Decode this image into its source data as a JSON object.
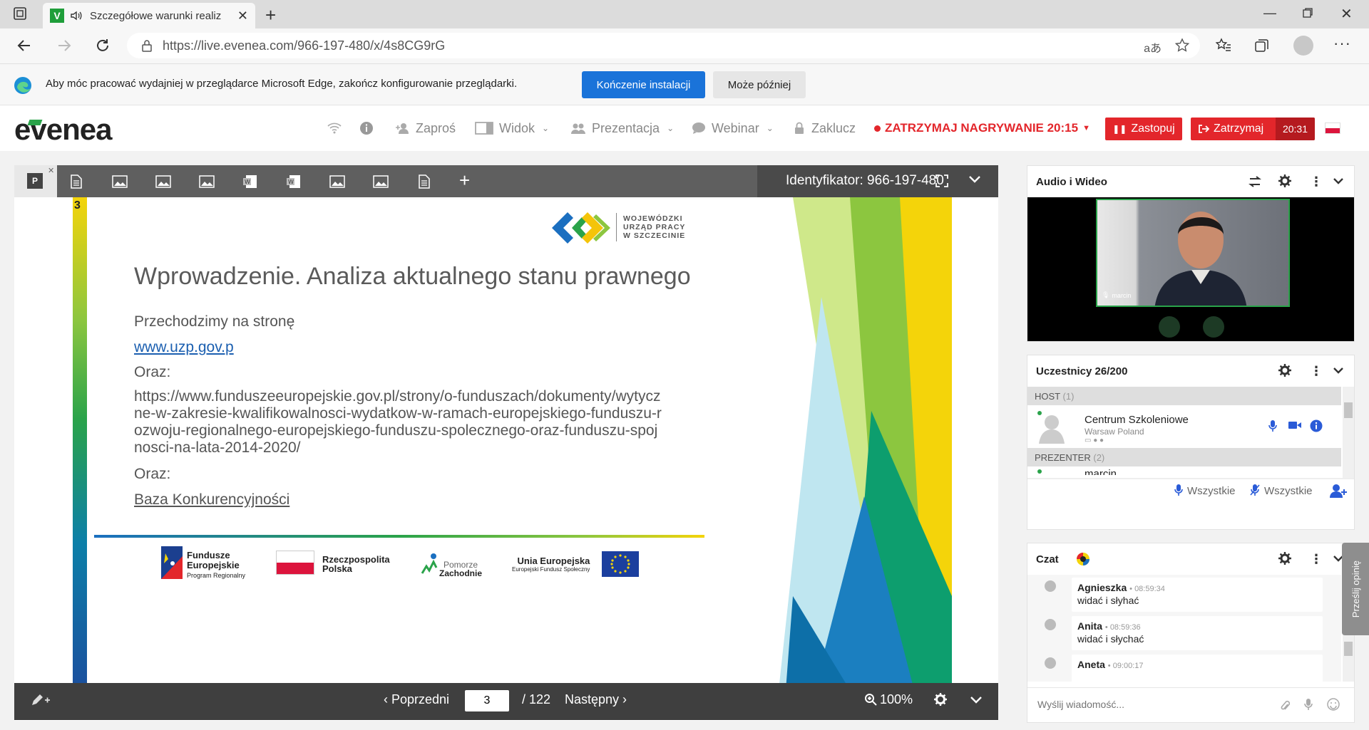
{
  "browser": {
    "tab_title": "Szczegółowe warunki realiz",
    "url": "https://live.evenea.com/966-197-480/x/4s8CG9rG"
  },
  "infobar": {
    "message": "Aby móc pracować wydajniej w przeglądarce Microsoft Edge, zakończ konfigurowanie przeglądarki.",
    "primary_button": "Kończenie instalacji",
    "secondary_button": "Może później"
  },
  "header": {
    "logo": "evenea",
    "nav": {
      "invite": "Zaproś",
      "view": "Widok",
      "presentation": "Prezentacja",
      "webinar": "Webinar",
      "lock": "Zaklucz"
    },
    "recording": "ZATRZYMAJ NAGRYWANIE 20:15",
    "replace_button": "Zastopuj",
    "stop_button": "Zatrzymaj",
    "stop_timer": "20:31"
  },
  "presentation": {
    "identifier": "Identyfikator: 966-197-480",
    "slide_number": "3",
    "slide": {
      "logo_lines": [
        "WOJEWÓDZKI",
        "URZĄD PRACY",
        "W SZCZECINIE"
      ],
      "title": "Wprowadzenie. Analiza aktualnego stanu prawnego",
      "line1": "Przechodzimy na stronę",
      "link1": "www.uzp.gov.p",
      "oraz1": "Oraz:",
      "long_url": "https://www.funduszeeuropejskie.gov.pl/strony/o-funduszach/dokumenty/wytyczne-w-zakresie-kwalifikowalnosci-wydatkow-w-ramach-europejskiego-funduszu-rozwoju-regionalnego-europejskiego-funduszu-spolecznego-oraz-funduszu-spojnosci-na-lata-2014-2020/",
      "oraz2": "Oraz:",
      "link2": "Baza Konkurencyjności",
      "footer": {
        "fe_line1": "Fundusze",
        "fe_line2": "Europejskie",
        "fe_line3": "Program Regionalny",
        "rp_line1": "Rzeczpospolita",
        "rp_line2": "Polska",
        "pz_line1": "Pomorze",
        "pz_line2": "Zachodnie",
        "ue_line1": "Unia Europejska",
        "ue_line2": "Europejski Fundusz Społeczny"
      }
    },
    "nav": {
      "prev": "Poprzedni",
      "page": "3",
      "total": "/ 122",
      "next": "Następny",
      "zoom": "100%"
    }
  },
  "av_panel": {
    "title": "Audio i Wideo",
    "video_name": "marcin"
  },
  "participants": {
    "title": "Uczestnicy 26/200",
    "host_section": "HOST",
    "host_count": "(1)",
    "host_name": "Centrum Szkoleniowe",
    "host_location": "Warsaw Poland",
    "presenter_section": "PREZENTER",
    "presenter_count": "(2)",
    "presenter_name": "marcin",
    "all_audio": "Wszystkie",
    "all_mic": "Wszystkie"
  },
  "chat": {
    "title": "Czat",
    "messages": [
      {
        "name": "Agnieszka",
        "time": "08:59:34",
        "text": "widać i  słyhać"
      },
      {
        "name": "Anita",
        "time": "08:59:36",
        "text": "widać i słychać"
      },
      {
        "name": "Aneta",
        "time": "09:00:17",
        "text": ""
      }
    ],
    "placeholder": "Wyślij wiadomość...",
    "feedback": "Prześlij opinię"
  },
  "colors": {
    "accent_blue": "#1a73d9",
    "record_red": "#e3262b",
    "evenea_green": "#2aa34a"
  }
}
